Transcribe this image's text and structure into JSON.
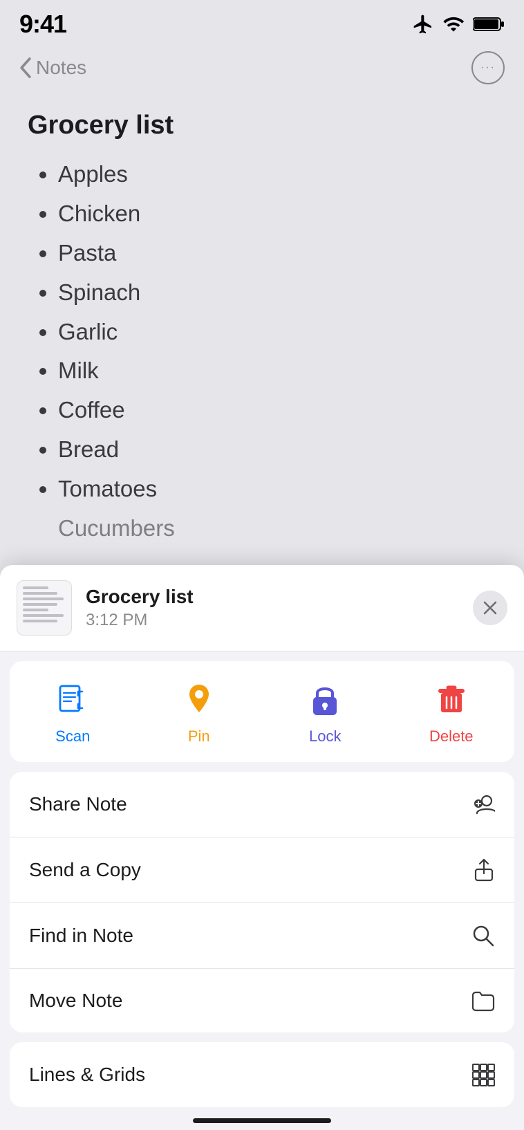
{
  "statusBar": {
    "time": "9:41",
    "airplaneMode": true,
    "wifi": true,
    "battery": "full"
  },
  "navBar": {
    "backLabel": "Notes",
    "moreLabel": "···"
  },
  "note": {
    "title": "Grocery list",
    "items": [
      "Apples",
      "Chicken",
      "Pasta",
      "Spinach",
      "Garlic",
      "Milk",
      "Coffee",
      "Bread",
      "Tomatoes",
      "Cucumbers"
    ]
  },
  "notePreview": {
    "title": "Grocery list",
    "time": "3:12 PM"
  },
  "closeButton": "×",
  "actions": [
    {
      "id": "scan",
      "label": "Scan",
      "colorClass": "scan"
    },
    {
      "id": "pin",
      "label": "Pin",
      "colorClass": "pin"
    },
    {
      "id": "lock",
      "label": "Lock",
      "colorClass": "lock"
    },
    {
      "id": "delete",
      "label": "Delete",
      "colorClass": "delete"
    }
  ],
  "menuItems": [
    {
      "id": "share-note",
      "label": "Share Note"
    },
    {
      "id": "send-copy",
      "label": "Send a Copy"
    },
    {
      "id": "find-in-note",
      "label": "Find in Note"
    },
    {
      "id": "move-note",
      "label": "Move Note"
    }
  ],
  "linesGrids": {
    "label": "Lines & Grids"
  }
}
